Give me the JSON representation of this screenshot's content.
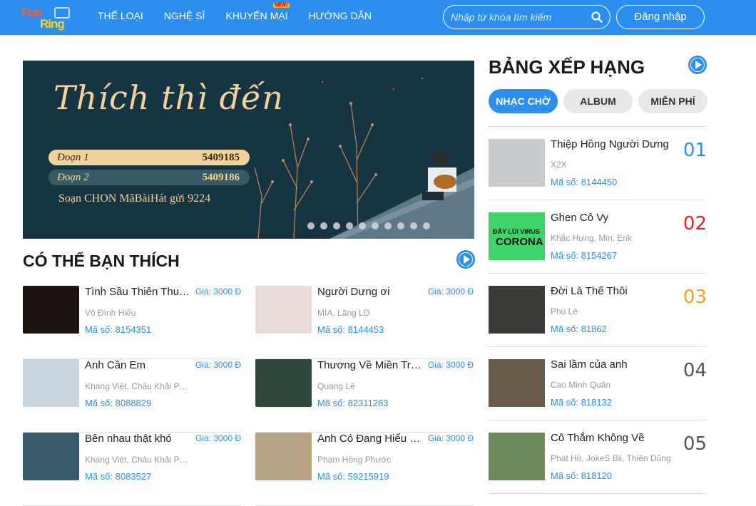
{
  "header": {
    "logo_text_1": "Fun",
    "logo_text_2": "Ring",
    "nav": [
      {
        "label": "THỂ LOẠI"
      },
      {
        "label": "NGHỆ SĨ"
      },
      {
        "label": "KHUYẾN MẠI",
        "badge": "NEW!"
      },
      {
        "label": "HƯỚNG DẪN"
      }
    ],
    "search_placeholder": "Nhập từ khóa tìm kiếm",
    "login_label": "Đăng nhập",
    "accent_color": "#2c8ff0"
  },
  "banner": {
    "headline": "Thích thì đến",
    "codes": [
      {
        "label": "Đoạn 1",
        "value": "5409185"
      },
      {
        "label": "Đoạn 2",
        "value": "5409186"
      }
    ],
    "instruction": "Soạn CHON MãBàiHát gửi 9224",
    "slide_count": 10
  },
  "suggestions": {
    "title": "CÓ THỂ BẠN THÍCH",
    "items": [
      {
        "name": "Tình Sầu Thiên Thu Muôn Lối",
        "price": "Giá: 3000 Đ",
        "artist": "Võ Đình Hiếu",
        "code": "Mã số: 8154351",
        "thumb_color": "#1c1410"
      },
      {
        "name": "Người Dưng ơi",
        "price": "Giá: 3000 Đ",
        "artist": "MIA, Lăng LD",
        "code": "Mã số: 8144453",
        "thumb_color": "#e9dcd8"
      },
      {
        "name": "Anh Cần Em",
        "price": "Giá: 3000 Đ",
        "artist": "Khang Việt, Châu Khải Phong",
        "code": "Mã số: 8088829",
        "thumb_color": "#c9d6e0"
      },
      {
        "name": "Thương Về Miền Trung",
        "price": "Giá: 3000 Đ",
        "artist": "Quang Lê",
        "code": "Mã số: 82311283",
        "thumb_color": "#2e4a3a"
      },
      {
        "name": "Bên nhau thật khó",
        "price": "Giá: 3000 Đ",
        "artist": "Khang Việt, Châu Khải Phong",
        "code": "Mã số: 8083527",
        "thumb_color": "#3a5b6e"
      },
      {
        "name": "Anh Có Đang Hiểu Em Không",
        "price": "Giá: 3000 Đ",
        "artist": "Phạm Hồng Phước",
        "code": "Mã số: 59215919",
        "thumb_color": "#b8a382"
      }
    ]
  },
  "ranking": {
    "title": "BẢNG XẾP HẠNG",
    "tabs": [
      {
        "label": "NHẠC CHỜ",
        "active": true
      },
      {
        "label": "ALBUM",
        "active": false
      },
      {
        "label": "MIỄN PHÍ",
        "active": false
      }
    ],
    "items": [
      {
        "name": "Thiệp Hồng Người Dưng",
        "artist": "X2X",
        "code": "Mã số: 8144450",
        "rank": "01",
        "rank_color": "#2c8ff0",
        "thumb_color": "#c8ccd0"
      },
      {
        "name": "Ghen Cô Vy",
        "artist": "Khắc Hưng, Min, Erik",
        "code": "Mã số: 8154267",
        "rank": "02",
        "rank_color": "#e02424",
        "thumb_color": "#3fd46a",
        "thumb_text_1": "ĐẨY LÙI VIRUS",
        "thumb_text_2": "CORONA"
      },
      {
        "name": "Đời Là Thế Thôi",
        "artist": "Phú Lê",
        "code": "Mã số: 81862",
        "rank": "03",
        "rank_color": "#f0a020",
        "thumb_color": "#3b3a36"
      },
      {
        "name": "Sai lầm của anh",
        "artist": "Cao Minh Quân",
        "code": "Mã số: 818132",
        "rank": "04",
        "rank_color": "#555555",
        "thumb_color": "#6a5c4a"
      },
      {
        "name": "Cô Thắm Không Về",
        "artist": "Phát Hồ, JokeS Bii, Thiên Dũng",
        "code": "Mã số: 818120",
        "rank": "05",
        "rank_color": "#555555",
        "thumb_color": "#6c8a5a"
      }
    ]
  }
}
